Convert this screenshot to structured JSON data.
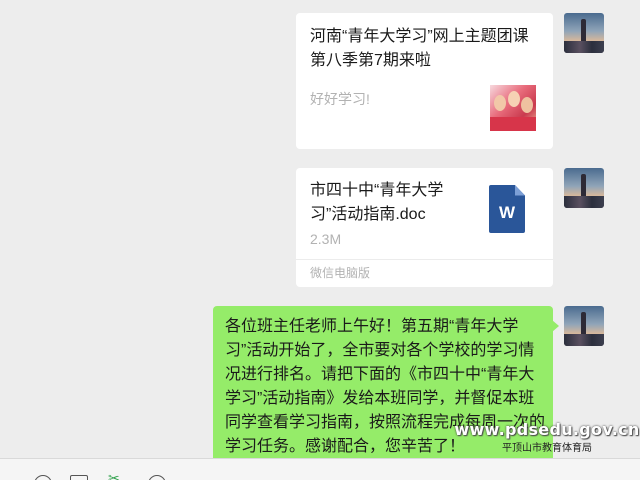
{
  "messages": {
    "link_card": {
      "title": "河南“青年大学习”网上主题团课第八季第7期来啦",
      "description": "好好学习!",
      "thumbnail": "campaign-thumbnail"
    },
    "file_card": {
      "filename": "市四十中“青年大学习”活动指南.doc",
      "size": "2.3M",
      "source": "微信电脑版",
      "icon": "word-doc-icon",
      "icon_letter": "W"
    },
    "text_bubble": {
      "text": "各位班主任老师上午好！第五期“青年大学习”活动开始了，全市要对各个学校的学习情况进行排名。请把下面的《市四十中“青年大学习”活动指南》发给本班同学，并督促本班同学查看学习指南，按照流程完成每周一次的学习任务。感谢配合，您辛苦了！"
    }
  },
  "watermark": {
    "url": "www.pdsedu.gov.cn",
    "org": "平顶山市教育体育局"
  },
  "toolbar": {
    "icons": [
      "emoji-icon",
      "folder-icon",
      "screenshot-icon",
      "chat-history-icon"
    ]
  },
  "colors": {
    "chat_background": "#ededed",
    "sent_bubble": "#95ec69",
    "card_background": "#ffffff",
    "word_blue": "#2a5699"
  }
}
